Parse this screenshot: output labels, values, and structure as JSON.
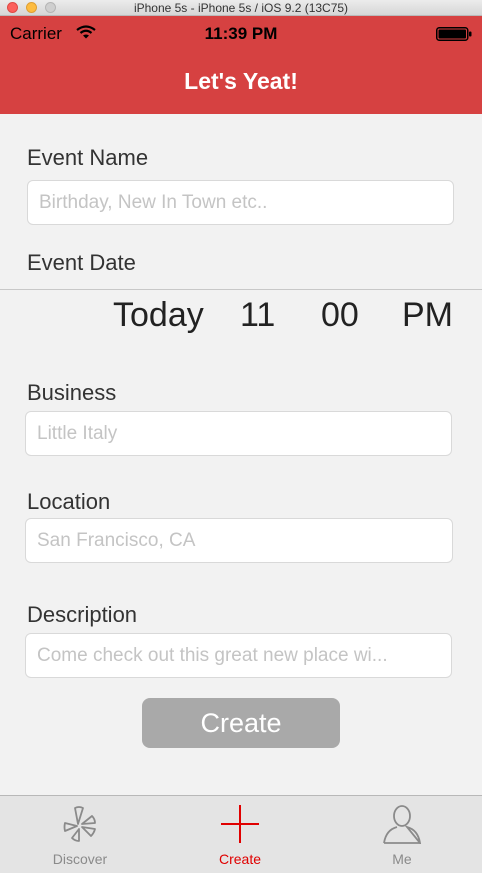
{
  "simulator": {
    "title": "iPhone 5s - iPhone 5s / iOS 9.2 (13C75)"
  },
  "status_bar": {
    "carrier": "Carrier",
    "time": "11:39 PM"
  },
  "nav": {
    "title": "Let's Yeat!"
  },
  "form": {
    "event_name": {
      "label": "Event Name",
      "placeholder": "Birthday, New In Town etc.."
    },
    "event_date": {
      "label": "Event Date",
      "picker": {
        "day": "Today",
        "hour": "11",
        "minute": "00",
        "ampm": "PM"
      }
    },
    "business": {
      "label": "Business",
      "placeholder": "Little Italy"
    },
    "location": {
      "label": "Location",
      "placeholder": "San Francisco, CA"
    },
    "description": {
      "label": "Description",
      "placeholder": "Come check out this great new place wi..."
    },
    "submit_label": "Create"
  },
  "tabs": [
    {
      "label": "Discover",
      "icon": "yelp-burst-icon"
    },
    {
      "label": "Create",
      "icon": "plus-icon"
    },
    {
      "label": "Me",
      "icon": "person-icon"
    }
  ],
  "colors": {
    "nav_bar": "#d64141",
    "active_tab": "#e00000",
    "button_disabled": "#a9a9a9"
  }
}
